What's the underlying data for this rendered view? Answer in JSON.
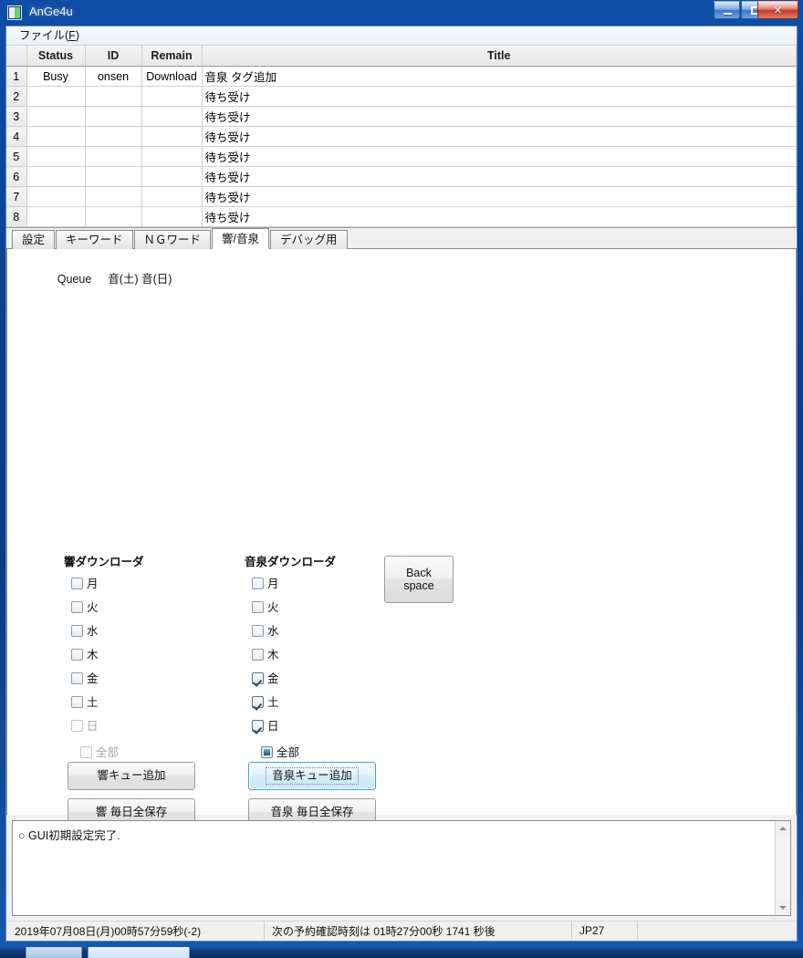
{
  "window": {
    "title": "AnGe4u",
    "icon": "app-icon",
    "buttons": {
      "minimize": "minimize",
      "maximize": "maximize",
      "close": "x"
    }
  },
  "menubar": {
    "file_prefix": "ファイル(",
    "file_mnemonic": "F",
    "file_suffix": ")"
  },
  "grid": {
    "headers": [
      "",
      "Status",
      "ID",
      "Remain",
      "Title"
    ],
    "rows": [
      {
        "num": "1",
        "status": "Busy",
        "id": "onsen",
        "remain": "Download",
        "title": "音泉 タグ追加"
      },
      {
        "num": "2",
        "status": "",
        "id": "",
        "remain": "",
        "title": "待ち受け"
      },
      {
        "num": "3",
        "status": "",
        "id": "",
        "remain": "",
        "title": "待ち受け"
      },
      {
        "num": "4",
        "status": "",
        "id": "",
        "remain": "",
        "title": "待ち受け"
      },
      {
        "num": "5",
        "status": "",
        "id": "",
        "remain": "",
        "title": "待ち受け"
      },
      {
        "num": "6",
        "status": "",
        "id": "",
        "remain": "",
        "title": "待ち受け"
      },
      {
        "num": "7",
        "status": "",
        "id": "",
        "remain": "",
        "title": "待ち受け"
      },
      {
        "num": "8",
        "status": "",
        "id": "",
        "remain": "",
        "title": "待ち受け"
      }
    ]
  },
  "tabs": [
    {
      "label": "設定",
      "selected": false
    },
    {
      "label": "キーワード",
      "selected": false
    },
    {
      "label": "ＮＧワード",
      "selected": false
    },
    {
      "label": "響/音泉",
      "selected": true
    },
    {
      "label": "デバッグ用",
      "selected": false
    }
  ],
  "page": {
    "queue_label": "Queue",
    "queue_value": "音(土) 音(日)",
    "left_group": {
      "title": "響ダウンローダ",
      "days": [
        {
          "label": "月",
          "state": "unchecked",
          "disabled": false
        },
        {
          "label": "火",
          "state": "unchecked",
          "disabled": false
        },
        {
          "label": "水",
          "state": "unchecked",
          "disabled": false
        },
        {
          "label": "木",
          "state": "unchecked",
          "disabled": false
        },
        {
          "label": "金",
          "state": "unchecked",
          "disabled": false
        },
        {
          "label": "土",
          "state": "unchecked",
          "disabled": false
        },
        {
          "label": "日",
          "state": "unchecked",
          "disabled": true
        }
      ],
      "all": {
        "label": "全部",
        "state": "unchecked",
        "disabled": true
      },
      "queue_button": "響キュー追加",
      "save_button": "響 毎日全保存"
    },
    "right_group": {
      "title": "音泉ダウンローダ",
      "days": [
        {
          "label": "月",
          "state": "unchecked",
          "disabled": false
        },
        {
          "label": "火",
          "state": "unchecked",
          "disabled": false
        },
        {
          "label": "水",
          "state": "unchecked",
          "disabled": false
        },
        {
          "label": "木",
          "state": "unchecked",
          "disabled": false
        },
        {
          "label": "金",
          "state": "checked",
          "disabled": false
        },
        {
          "label": "土",
          "state": "checked",
          "disabled": false
        },
        {
          "label": "日",
          "state": "checked",
          "disabled": false
        }
      ],
      "all": {
        "label": "全部",
        "state": "indeterminate",
        "disabled": false
      },
      "queue_button": "音泉キュー追加",
      "save_button": "音泉 毎日全保存"
    },
    "backspace_button_line1": "Back",
    "backspace_button_line2": "space"
  },
  "log": {
    "line1": "○ GUI初期設定完了."
  },
  "statusbar": {
    "time": "2019年07月08日(月)00時57分59秒(-2)",
    "next_check": "次の予約確認時刻は 01時27分00秒  1741 秒後",
    "locale": "JP27",
    "rest": ""
  },
  "colors": {
    "titlebar": "#0b3f8c",
    "accent": "#3c9fd6",
    "close": "#c0392a",
    "selected_tab": "#ffffff"
  }
}
